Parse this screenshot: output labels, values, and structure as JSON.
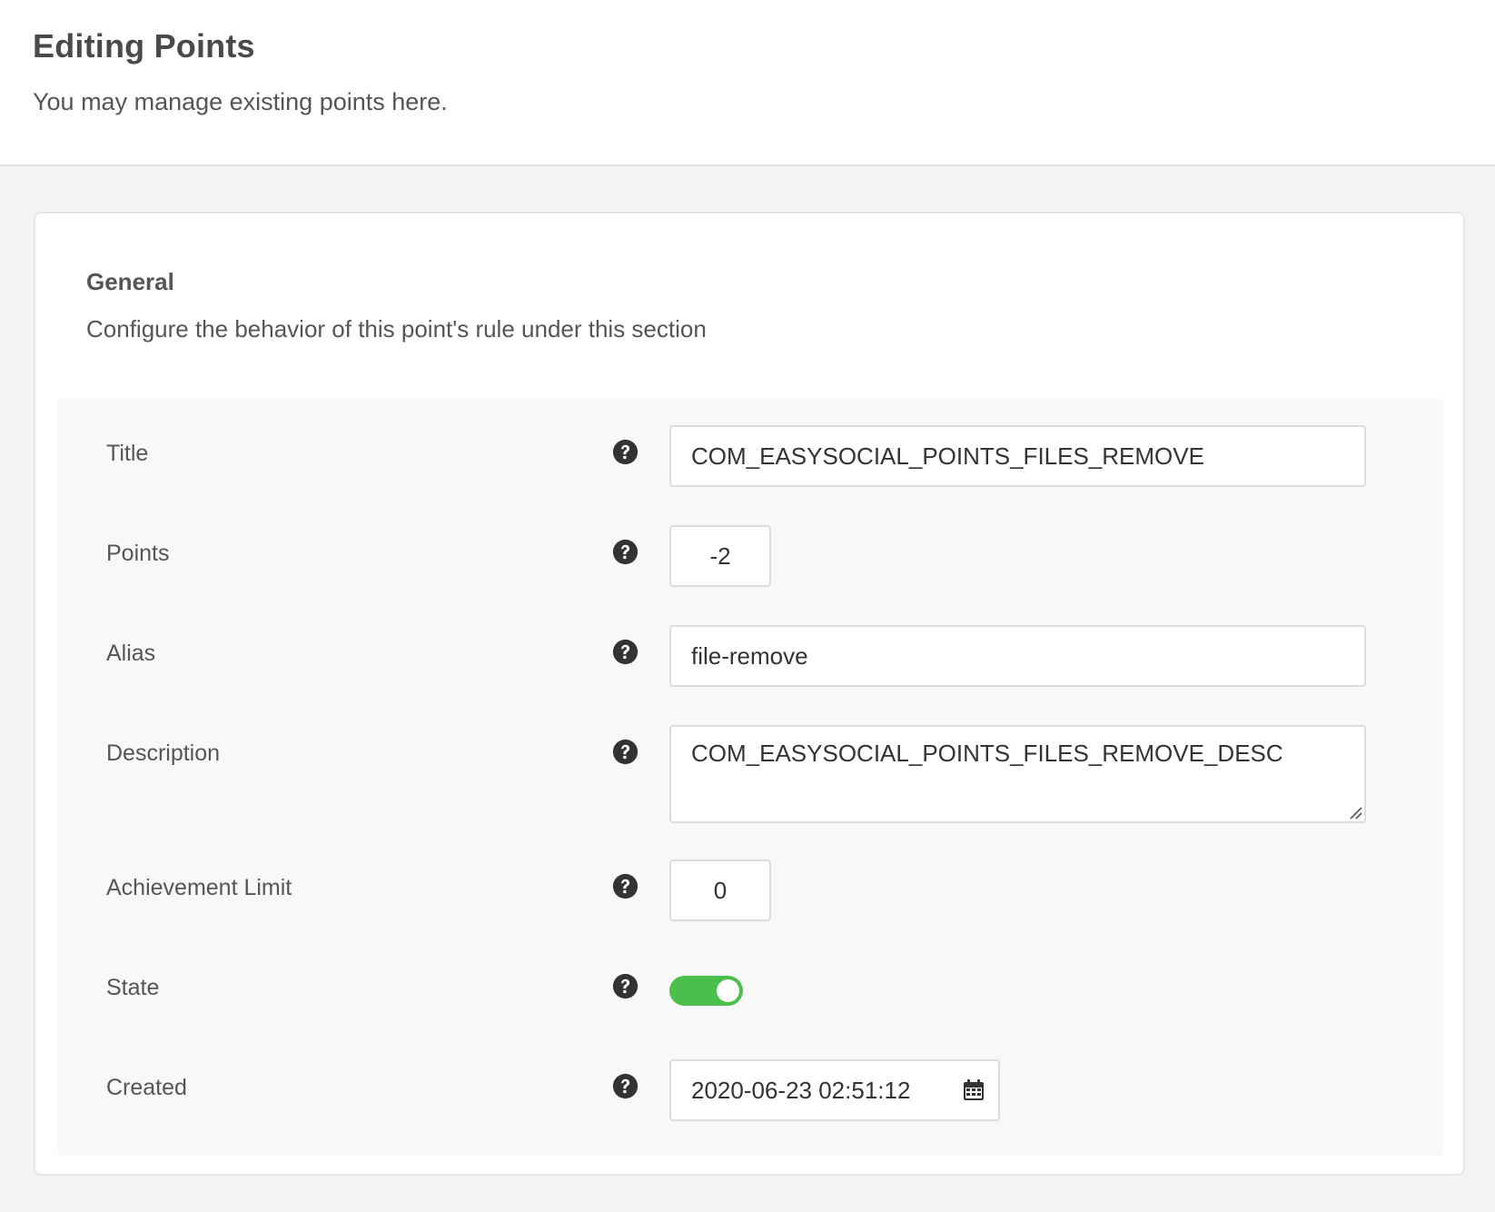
{
  "header": {
    "title": "Editing Points",
    "subtitle": "You may manage existing points here."
  },
  "section": {
    "title": "General",
    "description": "Configure the behavior of this point's rule under this section"
  },
  "fields": {
    "title": {
      "label": "Title",
      "value": "COM_EASYSOCIAL_POINTS_FILES_REMOVE"
    },
    "points": {
      "label": "Points",
      "value": "-2"
    },
    "alias": {
      "label": "Alias",
      "value": "file-remove"
    },
    "description": {
      "label": "Description",
      "value": "COM_EASYSOCIAL_POINTS_FILES_REMOVE_DESC"
    },
    "achievement_limit": {
      "label": "Achievement Limit",
      "value": "0"
    },
    "state": {
      "label": "State",
      "enabled": true
    },
    "created": {
      "label": "Created",
      "value": "2020-06-23 02:51:12"
    }
  },
  "icons": {
    "help": "question-circle-icon",
    "calendar": "calendar-icon"
  },
  "colors": {
    "toggle_on": "#4bbf4b",
    "help_icon": "#333333"
  }
}
